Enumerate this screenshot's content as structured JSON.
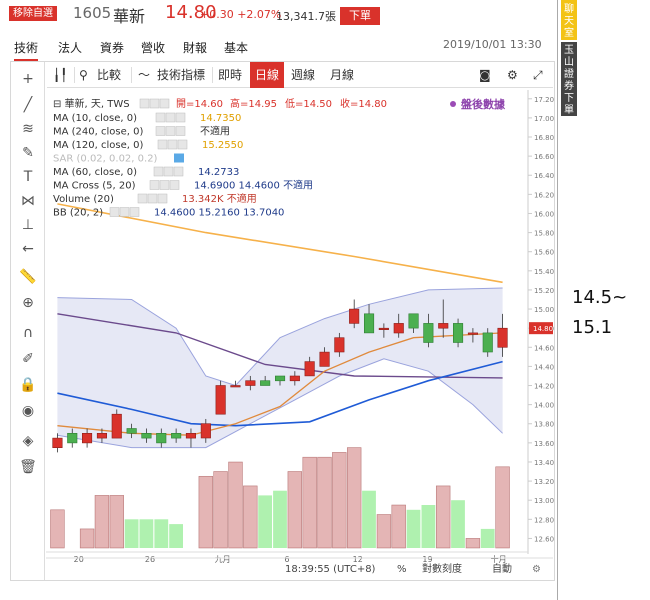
{
  "header": {
    "badge": "移除自選",
    "code": "1605",
    "name": "華新",
    "price": "14.80",
    "change": "+0.30 +2.07%",
    "volume": "13,341.7張",
    "order_button": "下單"
  },
  "tabs": [
    "技術",
    "法人",
    "資券",
    "營收",
    "財報",
    "基本"
  ],
  "datetime": "2019/10/01 13:30",
  "side": {
    "chat": "聊天室",
    "esun": "玉山證券下單"
  },
  "note_line1": "14.5~",
  "note_line2": "15.1",
  "toolbar": {
    "compare": "比較",
    "indicators": "技術指標",
    "realtime": "即時",
    "daily": "日線",
    "weekly": "週線",
    "monthly": "月線"
  },
  "legend": {
    "main": "華新, 天, TWS",
    "ohlc_open_label": "開=",
    "ohlc_open": "14.60",
    "ohlc_high_label": "高=",
    "ohlc_high": "14.95",
    "ohlc_low_label": "低=",
    "ohlc_low": "14.50",
    "ohlc_close_label": "收=",
    "ohlc_close": "14.80",
    "after_hours": "盤後數據",
    "rows": [
      {
        "label": "MA (10, close, 0)",
        "value": "14.7350",
        "color": "#e0a000"
      },
      {
        "label": "MA (240, close, 0)",
        "value": "不適用",
        "color": "#333333"
      },
      {
        "label": "MA (120, close, 0)",
        "value": "15.2550",
        "color": "#e0a000"
      },
      {
        "label": "SAR (0.02, 0.02, 0.2)",
        "value": "",
        "color": "#cccccc"
      },
      {
        "label": "MA (60, close, 0)",
        "value": "14.2733",
        "color": "#1f3b8a"
      },
      {
        "label": "MA Cross (5, 20)",
        "value": "14.6900  14.4600  不適用",
        "color": "#1f3b8a"
      },
      {
        "label": "Volume (20)",
        "value": "13.342K  不適用",
        "color": "#c0392b"
      },
      {
        "label": "BB (20, 2)",
        "value": "14.4600  15.2160  13.7040",
        "color": "#1f3b8a"
      }
    ]
  },
  "price_axis": [
    "17.20",
    "17.00",
    "16.80",
    "16.60",
    "16.40",
    "16.20",
    "16.00",
    "15.80",
    "15.60",
    "15.40",
    "15.20",
    "15.00",
    "14.80",
    "14.60",
    "14.40",
    "14.20",
    "14.00",
    "13.80",
    "13.60",
    "13.40",
    "13.20",
    "13.00",
    "12.80",
    "12.60"
  ],
  "current_price_tag": "14.80",
  "x_axis": [
    "20",
    "26",
    "九月",
    "6",
    "12",
    "19",
    "十月"
  ],
  "status_bar": {
    "time": "18:39:55 (UTC+8)",
    "percent": "%",
    "log": "對數刻度",
    "auto": "自動"
  },
  "colors": {
    "up": "#d9322b",
    "down": "#4caf50",
    "accent": "#d9322b"
  },
  "chart_data": {
    "type": "candlestick",
    "candles": [
      {
        "o": 13.55,
        "h": 13.7,
        "l": 13.5,
        "c": 13.65
      },
      {
        "o": 13.7,
        "h": 13.75,
        "l": 13.55,
        "c": 13.6
      },
      {
        "o": 13.6,
        "h": 13.75,
        "l": 13.55,
        "c": 13.7
      },
      {
        "o": 13.65,
        "h": 13.75,
        "l": 13.6,
        "c": 13.7
      },
      {
        "o": 13.65,
        "h": 13.95,
        "l": 13.65,
        "c": 13.9
      },
      {
        "o": 13.75,
        "h": 13.8,
        "l": 13.65,
        "c": 13.7
      },
      {
        "o": 13.7,
        "h": 13.75,
        "l": 13.6,
        "c": 13.65
      },
      {
        "o": 13.7,
        "h": 13.75,
        "l": 13.55,
        "c": 13.6
      },
      {
        "o": 13.7,
        "h": 13.75,
        "l": 13.6,
        "c": 13.65
      },
      {
        "o": 13.65,
        "h": 13.75,
        "l": 13.55,
        "c": 13.7
      },
      {
        "o": 13.65,
        "h": 13.85,
        "l": 13.6,
        "c": 13.8
      },
      {
        "o": 13.9,
        "h": 14.25,
        "l": 13.9,
        "c": 14.2
      },
      {
        "o": 14.2,
        "h": 14.25,
        "l": 14.2,
        "c": 14.2
      },
      {
        "o": 14.2,
        "h": 14.3,
        "l": 14.15,
        "c": 14.25
      },
      {
        "o": 14.25,
        "h": 14.3,
        "l": 14.2,
        "c": 14.2
      },
      {
        "o": 14.3,
        "h": 14.3,
        "l": 14.2,
        "c": 14.25
      },
      {
        "o": 14.25,
        "h": 14.35,
        "l": 14.2,
        "c": 14.3
      },
      {
        "o": 14.3,
        "h": 14.5,
        "l": 14.3,
        "c": 14.45
      },
      {
        "o": 14.4,
        "h": 14.6,
        "l": 14.4,
        "c": 14.55
      },
      {
        "o": 14.55,
        "h": 14.75,
        "l": 14.5,
        "c": 14.7
      },
      {
        "o": 14.85,
        "h": 15.1,
        "l": 14.8,
        "c": 15.0
      },
      {
        "o": 14.95,
        "h": 15.05,
        "l": 14.75,
        "c": 14.75
      },
      {
        "o": 14.8,
        "h": 14.85,
        "l": 14.7,
        "c": 14.8
      },
      {
        "o": 14.75,
        "h": 14.95,
        "l": 14.7,
        "c": 14.85
      },
      {
        "o": 14.95,
        "h": 14.95,
        "l": 14.75,
        "c": 14.8
      },
      {
        "o": 14.85,
        "h": 14.95,
        "l": 14.6,
        "c": 14.65
      },
      {
        "o": 14.8,
        "h": 15.1,
        "l": 14.7,
        "c": 14.85
      },
      {
        "o": 14.85,
        "h": 14.9,
        "l": 14.6,
        "c": 14.65
      },
      {
        "o": 14.75,
        "h": 14.8,
        "l": 14.65,
        "c": 14.75
      },
      {
        "o": 14.75,
        "h": 14.8,
        "l": 14.5,
        "c": 14.55
      },
      {
        "o": 14.6,
        "h": 14.95,
        "l": 14.5,
        "c": 14.8
      }
    ],
    "volumes": [
      12.9,
      12.5,
      12.7,
      13.05,
      13.05,
      12.8,
      12.8,
      12.8,
      12.75,
      12.3,
      13.25,
      13.3,
      13.4,
      13.15,
      13.05,
      13.1,
      13.3,
      13.45,
      13.45,
      13.5,
      13.55,
      13.1,
      12.85,
      12.95,
      12.9,
      12.95,
      13.15,
      13.0,
      12.6,
      12.7,
      13.35
    ],
    "ma120": [
      [
        0,
        16.1
      ],
      [
        10,
        15.8
      ],
      [
        20,
        15.55
      ],
      [
        30,
        15.28
      ]
    ],
    "ma60": [
      [
        0,
        14.95
      ],
      [
        8,
        14.75
      ],
      [
        14,
        14.42
      ],
      [
        20,
        14.3
      ],
      [
        30,
        14.28
      ]
    ],
    "ma20_blue": [
      [
        0,
        14.12
      ],
      [
        5,
        13.95
      ],
      [
        9,
        13.8
      ],
      [
        12,
        13.78
      ],
      [
        17,
        13.82
      ],
      [
        21,
        14.05
      ],
      [
        25,
        14.25
      ],
      [
        30,
        14.45
      ]
    ],
    "ma10_orange": [
      [
        0,
        13.78
      ],
      [
        5,
        13.7
      ],
      [
        9,
        13.68
      ],
      [
        12,
        13.8
      ],
      [
        15,
        13.98
      ],
      [
        18,
        14.35
      ],
      [
        21,
        14.55
      ],
      [
        24,
        14.7
      ],
      [
        30,
        14.75
      ]
    ],
    "bb_upper": [
      [
        0,
        15.12
      ],
      [
        5,
        15.1
      ],
      [
        8,
        14.8
      ],
      [
        10,
        14.3
      ],
      [
        12,
        14.2
      ],
      [
        15,
        14.7
      ],
      [
        18,
        14.9
      ],
      [
        21,
        15.05
      ],
      [
        25,
        15.2
      ],
      [
        30,
        15.22
      ]
    ],
    "bb_lower": [
      [
        0,
        13.68
      ],
      [
        5,
        13.55
      ],
      [
        10,
        13.55
      ],
      [
        13,
        13.8
      ],
      [
        16,
        14.05
      ],
      [
        19,
        14.3
      ],
      [
        22,
        14.48
      ],
      [
        25,
        14.35
      ],
      [
        28,
        14.0
      ],
      [
        30,
        13.7
      ]
    ],
    "ylim": [
      12.5,
      17.25
    ]
  }
}
